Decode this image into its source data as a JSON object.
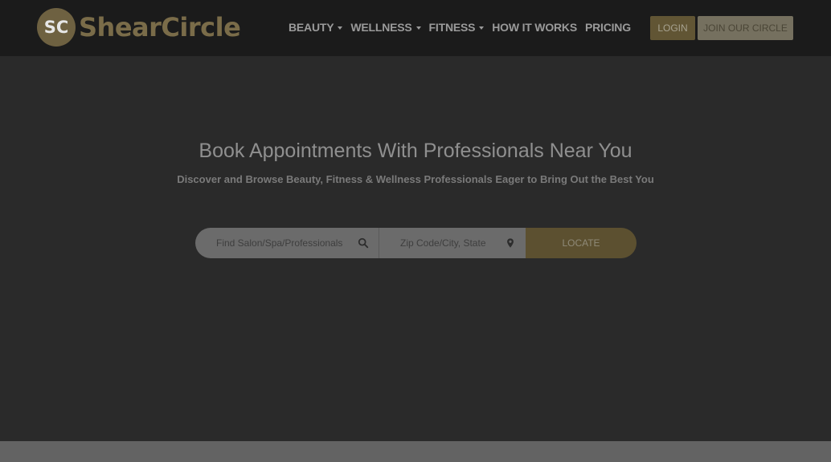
{
  "brand": {
    "badge": "SC",
    "name": "ShearCircle"
  },
  "nav": {
    "items": [
      {
        "label": "BEAUTY",
        "dropdown": true
      },
      {
        "label": "WELLNESS",
        "dropdown": true
      },
      {
        "label": "FITNESS",
        "dropdown": true
      },
      {
        "label": "HOW IT WORKS",
        "dropdown": false
      },
      {
        "label": "PRICING",
        "dropdown": false
      }
    ]
  },
  "header_buttons": {
    "login": "LOGIN",
    "join": "JOIN OUR CIRCLE"
  },
  "hero": {
    "title": "Book Appointments With Professionals Near You",
    "subtitle": "Discover and Browse Beauty, Fitness & Wellness Professionals Eager to Bring Out the Best You"
  },
  "search": {
    "service_placeholder": "Find Salon/Spa/Professionals",
    "service_value": "",
    "location_placeholder": "Zip Code/City, State",
    "location_value": "",
    "submit_label": "LOCATE",
    "service_icon": "search-icon",
    "location_icon": "map-marker-icon"
  },
  "colors": {
    "header_bg": "#1b1b1b",
    "hero_bg": "#2a2a2a",
    "accent_gold": "#615534",
    "footer_strip": "#636363"
  }
}
